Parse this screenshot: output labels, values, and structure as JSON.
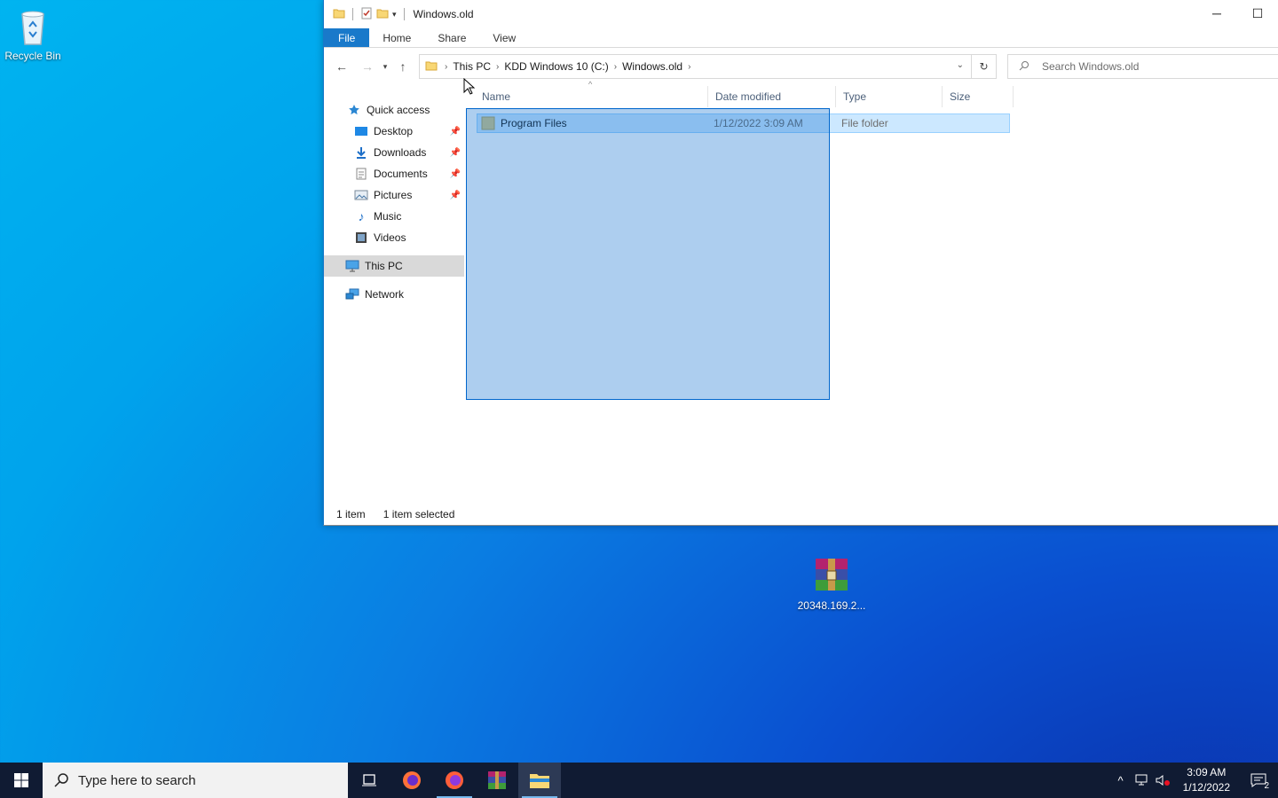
{
  "desktop": {
    "icons": [
      {
        "label": "Recycle Bin"
      },
      {
        "label": "20348.169.2..."
      }
    ]
  },
  "window": {
    "title": "Windows.old",
    "ribbon_tabs": [
      "File",
      "Home",
      "Share",
      "View"
    ],
    "breadcrumb": [
      "This PC",
      "KDD Windows 10 (C:)",
      "Windows.old"
    ],
    "search_placeholder": "Search Windows.old",
    "nav_pane": {
      "quick_access": "Quick access",
      "quick_items": [
        {
          "label": "Desktop",
          "icon": "desktop-icon",
          "pinned": true
        },
        {
          "label": "Downloads",
          "icon": "downloads-icon",
          "pinned": true
        },
        {
          "label": "Documents",
          "icon": "documents-icon",
          "pinned": true
        },
        {
          "label": "Pictures",
          "icon": "pictures-icon",
          "pinned": true
        },
        {
          "label": "Music",
          "icon": "music-icon",
          "pinned": false
        },
        {
          "label": "Videos",
          "icon": "videos-icon",
          "pinned": false
        }
      ],
      "this_pc": "This PC",
      "network": "Network"
    },
    "columns": [
      "Name",
      "Date modified",
      "Type",
      "Size"
    ],
    "rows": [
      {
        "name": "Program Files",
        "date": "1/12/2022 3:09 AM",
        "type": "File folder",
        "size": ""
      }
    ],
    "status": {
      "count": "1 item",
      "selected": "1 item selected"
    }
  },
  "taskbar": {
    "search_placeholder": "Type here to search",
    "clock_time": "3:09 AM",
    "clock_date": "1/12/2022",
    "notification_count": "2"
  }
}
